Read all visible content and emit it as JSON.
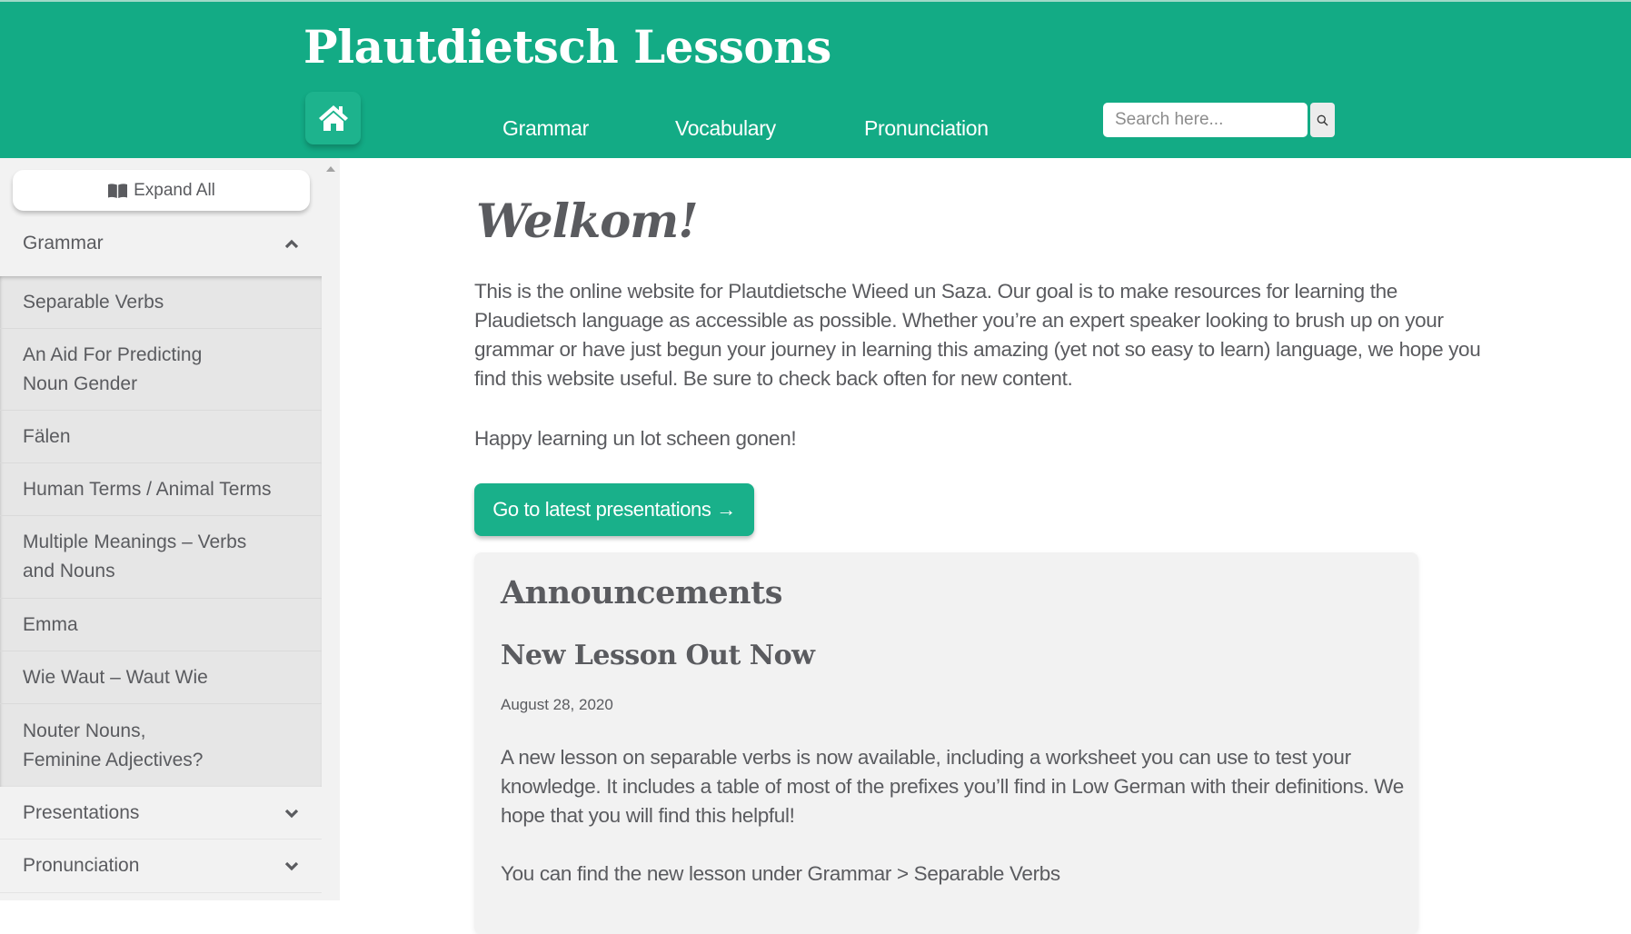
{
  "header": {
    "site_title": "Plautdietsch Lessons",
    "home_icon": "home-icon",
    "nav": [
      {
        "label": "Grammar"
      },
      {
        "label": "Vocabulary"
      },
      {
        "label": "Pronunciation"
      }
    ],
    "search": {
      "placeholder": "Search here...",
      "value": "",
      "icon": "search-icon"
    }
  },
  "sidebar": {
    "expand_all_label": "Expand All",
    "expand_icon": "book-icon",
    "sections": [
      {
        "label": "Grammar",
        "expanded": true,
        "items": [
          {
            "label": "Separable Verbs"
          },
          {
            "label": "An Aid For Predicting Noun Gender"
          },
          {
            "label": "Fälen"
          },
          {
            "label": "Human Terms / Animal Terms"
          },
          {
            "label": "Multiple Meanings – Verbs and Nouns"
          },
          {
            "label": "Emma"
          },
          {
            "label": "Wie Waut – Waut Wie"
          },
          {
            "label": "Nouter Nouns, Feminine Adjectives?"
          }
        ]
      },
      {
        "label": "Presentations",
        "expanded": false
      },
      {
        "label": "Pronunciation",
        "expanded": false
      }
    ]
  },
  "main": {
    "welcome_title": "Welkom!",
    "intro": "This is the online website for Plautdietsche Wieed un Saza. Our goal is to make resources for learning the Plaudietsch language as accessible as possible. Whether you’re an expert speaker looking to brush up on your grammar or have just begun your journey in learning this amazing (yet not so easy to learn) language, we hope you find this website useful. Be sure to check back often for new content.",
    "happy": "Happy learning un lot scheen gonen!",
    "cta_label": "Go to latest presentations →",
    "announcements": {
      "title": "Announcements",
      "post_title": "New Lesson Out Now",
      "post_date": "August 28, 2020",
      "post_body": "A new lesson on separable verbs is now available, including a worksheet you can use to test your knowledge. It includes a table of most of the prefixes you’ll find in Low German with their definitions. We hope that you will find this helpful!",
      "post_note": "You can find the new lesson under Grammar > Separable Verbs"
    }
  },
  "colors": {
    "brand": "#13ab85",
    "button": "#19b08a",
    "text": "#5a5b5f",
    "sidebar_bg": "#f2f2f2",
    "sublist_bg": "#e6e6e6"
  }
}
